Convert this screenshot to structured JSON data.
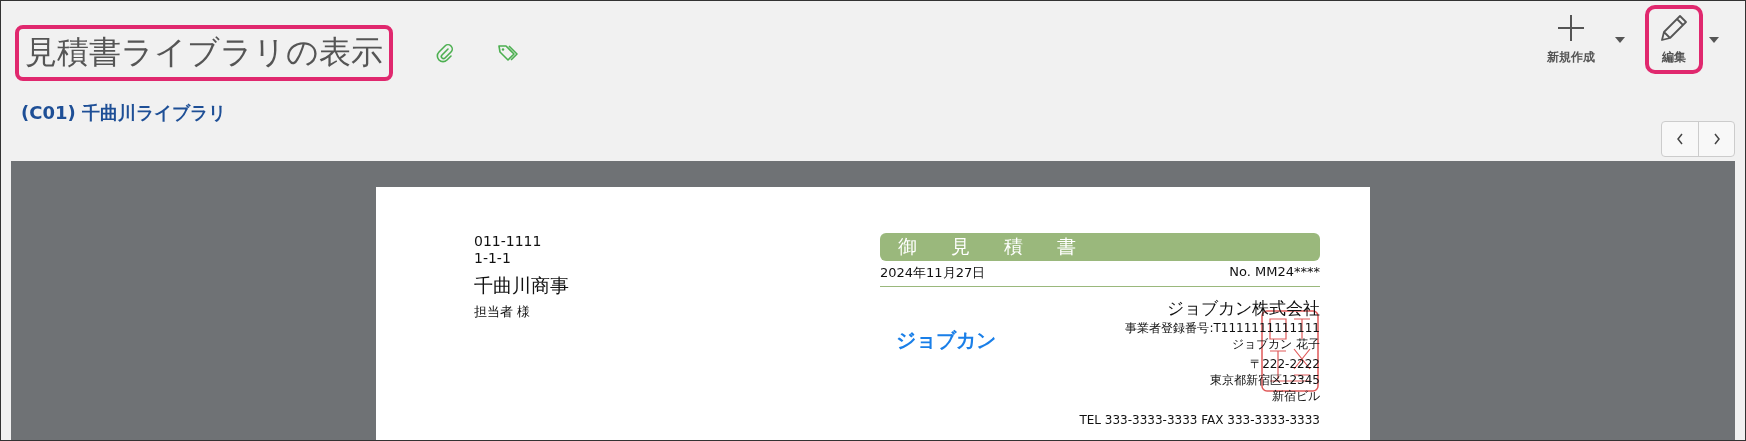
{
  "header": {
    "title": "見積書ライブラリの表示",
    "title_highlighted": true,
    "library": "(C01) 千曲川ライブラリ"
  },
  "toolbar": [
    {
      "kind": "new",
      "label": "新規作成",
      "highlighted": false
    },
    {
      "kind": "edit",
      "label": "編集",
      "highlighted": true
    }
  ],
  "document": {
    "recipient": {
      "postal": "011-1111",
      "address": "1-1-1",
      "company": "千曲川商事",
      "contact": "担当者 様"
    },
    "doc_title": "御 見 積 書",
    "date": "2024年11月27日",
    "number": "No. MM24****",
    "logo": "ジョブカン",
    "issuer": {
      "company": "ジョブカン株式会社",
      "registration": "事業者登録番号:T1111111111111",
      "person": "ジョブカン 花子",
      "postal": "〒222-2222",
      "address": "東京都新宿区12345",
      "building": "新宿ビル",
      "contact": "TEL 333-3333-3333 FAX 333-3333-3333"
    }
  }
}
